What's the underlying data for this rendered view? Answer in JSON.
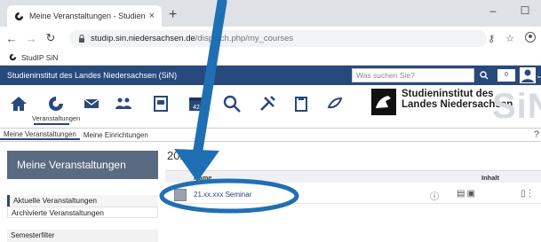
{
  "browser": {
    "tab_title": "Meine Veranstaltungen - Studien",
    "tab_close": "×",
    "new_tab": "+",
    "url_host": "studip.sin.niedersachsen.de",
    "url_path": "/dispatch.php/my_courses",
    "bookmark": "StudIP SiN",
    "window_min": "–",
    "window_max": "☐"
  },
  "header": {
    "institute": "Studieninstitut des Landes Niedersachsen (SiN)",
    "search_placeholder": "Was suchen Sie?",
    "notification_count": "0"
  },
  "nav": {
    "active_label": "Veranstaltungen",
    "calendar_day": "42",
    "brand_line1": "Studieninstitut des",
    "brand_line2": "Landes Niedersachsen",
    "brand_big": "SiN"
  },
  "tabs": {
    "meine_veranstaltungen": "Meine Veranstaltungen",
    "meine_einrichtungen": "Meine Einrichtungen",
    "help": "?"
  },
  "sidebar": {
    "title": "Meine Veranstaltungen",
    "items": [
      "Aktuelle Veranstaltungen",
      "Archivierte Veranstaltungen"
    ],
    "filter_title": "Semesterfilter"
  },
  "main": {
    "year": "2021",
    "col_name": "Name",
    "col_inhalt": "Inhalt",
    "course_name": "21.xx.xxx Seminar"
  },
  "colors": {
    "brand": "#28497c",
    "annotation": "#1f6fb5"
  }
}
